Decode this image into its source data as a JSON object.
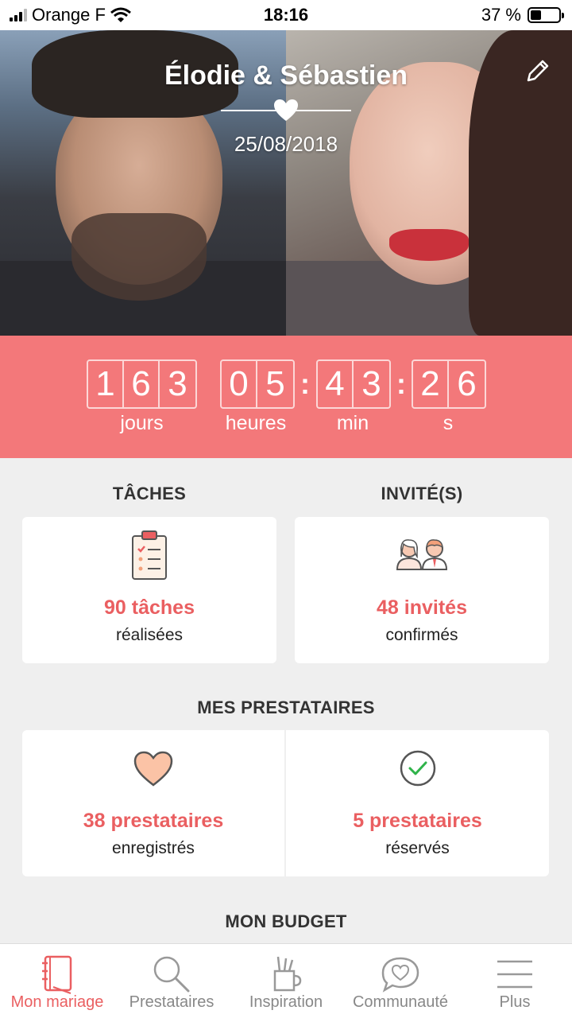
{
  "status": {
    "carrier": "Orange F",
    "time": "18:16",
    "battery_percent": "37 %",
    "battery_level": 0.37
  },
  "hero": {
    "names": "Élodie & Sébastien",
    "date": "25/08/2018"
  },
  "countdown": {
    "days": [
      "1",
      "6",
      "3"
    ],
    "hours": [
      "0",
      "5"
    ],
    "minutes": [
      "4",
      "3"
    ],
    "seconds": [
      "2",
      "6"
    ],
    "labels": {
      "days": "jours",
      "hours": "heures",
      "minutes": "min",
      "seconds": "s"
    }
  },
  "tasks": {
    "title": "TÂCHES",
    "count": "90 tâches",
    "sub": "réalisées"
  },
  "guests": {
    "title": "INVITÉ(S)",
    "count": "48 invités",
    "sub": "confirmés"
  },
  "vendors": {
    "title": "MES PRESTATAIRES",
    "saved": {
      "count": "38 prestataires",
      "sub": "enregistrés"
    },
    "booked": {
      "count": "5 prestataires",
      "sub": "réservés"
    }
  },
  "budget": {
    "title": "MON BUDGET"
  },
  "tabs": [
    {
      "label": "Mon mariage",
      "icon": "notebook-icon"
    },
    {
      "label": "Prestataires",
      "icon": "search-icon"
    },
    {
      "label": "Inspiration",
      "icon": "pencil-cup-icon"
    },
    {
      "label": "Communauté",
      "icon": "chat-heart-icon"
    },
    {
      "label": "Plus",
      "icon": "menu-icon"
    }
  ],
  "colors": {
    "accent": "#f3787a",
    "accent_text": "#ea5f61",
    "background": "#efefef"
  }
}
